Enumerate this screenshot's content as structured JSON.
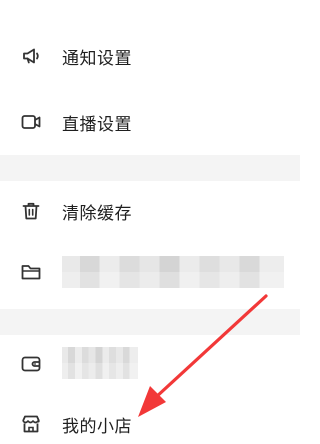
{
  "menu": {
    "items": [
      {
        "label": "通知设置",
        "icon": "megaphone-icon"
      },
      {
        "label": "直播设置",
        "icon": "video-camera-icon"
      },
      {
        "label": "清除缓存",
        "icon": "trash-icon"
      },
      {
        "label": "",
        "icon": "folder-icon"
      },
      {
        "label": "",
        "icon": "wallet-icon"
      },
      {
        "label": "我的小店",
        "icon": "store-icon"
      }
    ]
  },
  "colors": {
    "divider": "#f4f4f4",
    "arrow": "#f23838",
    "icon": "#333333"
  }
}
